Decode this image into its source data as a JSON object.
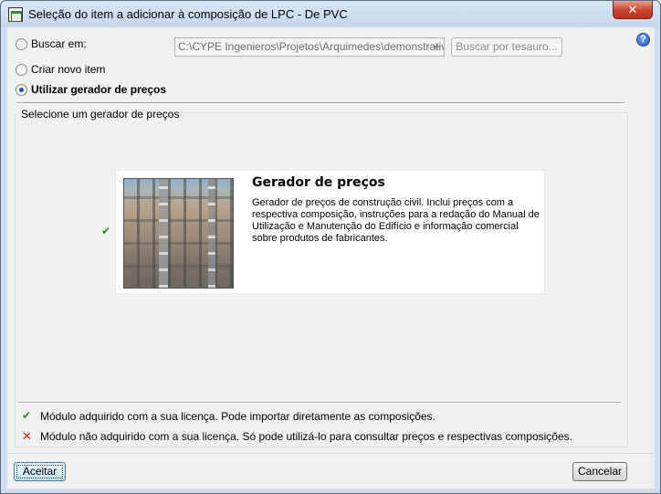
{
  "window": {
    "title": "Seleção do item a adicionar à composição de LPC - De PVC",
    "close_label": "✕"
  },
  "source": {
    "option_search_label": "Buscar em:",
    "path_value": "C:\\CYPE Ingenieros\\Projetos\\Arquimedes\\demonstrativo",
    "thesaurus_button_label": "Buscar por tesauro...",
    "option_new_item_label": "Criar novo item",
    "option_generator_label": "Utilizar gerador de preços",
    "selected_option": "Utilizar gerador de preços",
    "help_label": "?"
  },
  "generator_panel": {
    "group_title": "Selecione um gerador de preços",
    "card": {
      "title": "Gerador de preços",
      "description": "Gerador de preços de construção civil. Inclui preços com a respectiva composição, instruções para a redação do Manual de Utilização e Manutenção do Edifício e informação comercial sobre produtos de fabricantes.",
      "status": "acquired"
    }
  },
  "legend": {
    "acquired_text": "Módulo adquirido com a sua licença. Pode importar diretamente as composições.",
    "not_acquired_text": "Módulo não adquirido com a sua licença. Só pode utilizá-lo para consultar preços e respectivas composições.",
    "acquired_icon": "✔",
    "not_acquired_icon": "✕"
  },
  "footer": {
    "accept_label": "Aceitar",
    "cancel_label": "Cancelar"
  },
  "colors": {
    "titlebar": "#cfdfef",
    "close_button": "#c7442e",
    "acquired_check": "#2f8a1f",
    "not_acquired_x": "#d0241c"
  }
}
